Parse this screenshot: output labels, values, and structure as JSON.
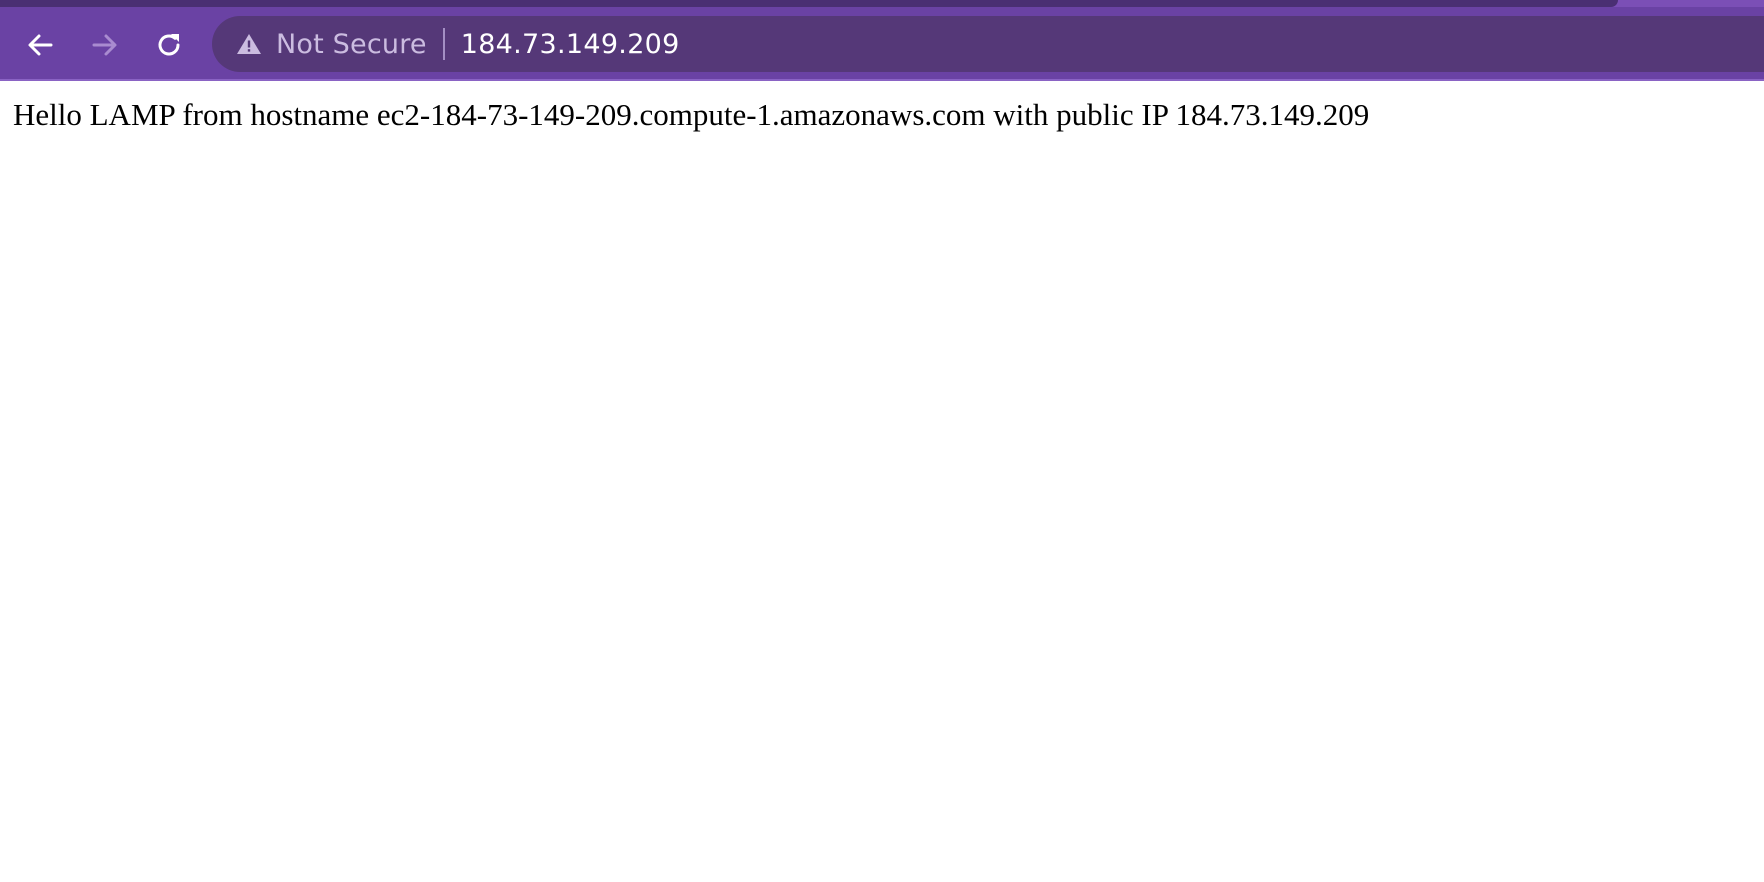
{
  "browser": {
    "toolbar": {
      "back_icon": "arrow-left-icon",
      "forward_icon": "arrow-right-icon",
      "reload_icon": "reload-icon"
    },
    "omnibox": {
      "security_icon": "warning-triangle-icon",
      "security_label": "Not Secure",
      "url": "184.73.149.209"
    },
    "colors": {
      "toolbar": "#6a42a4",
      "omnibox": "#553878",
      "tab_strip": "#4a2f73"
    }
  },
  "page": {
    "message": "Hello LAMP from hostname ec2-184-73-149-209.compute-1.amazonaws.com with public IP 184.73.149.209"
  }
}
